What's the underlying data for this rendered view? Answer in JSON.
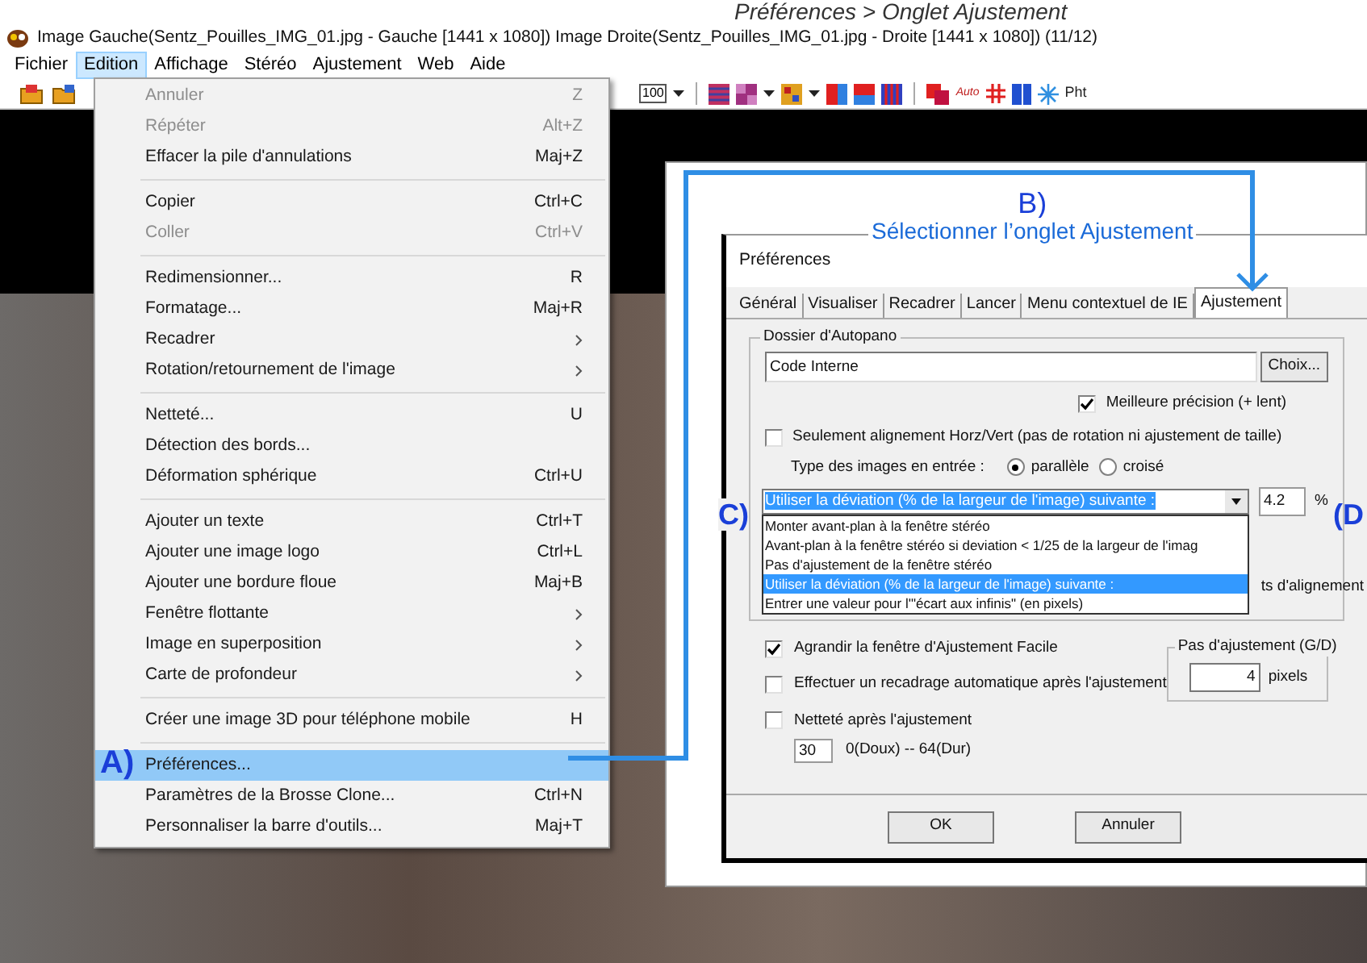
{
  "caption": "Préférences > Onglet Ajustement",
  "window": {
    "title": "Image Gauche(Sentz_Pouilles_IMG_01.jpg - Gauche [1441 x 1080]) Image Droite(Sentz_Pouilles_IMG_01.jpg - Droite [1441 x 1080])  (11/12)"
  },
  "menubar": [
    {
      "label": "Fichier",
      "selected": false
    },
    {
      "label": "Edition",
      "selected": true
    },
    {
      "label": "Affichage",
      "selected": false
    },
    {
      "label": "Stéréo",
      "selected": false
    },
    {
      "label": "Ajustement",
      "selected": false
    },
    {
      "label": "Web",
      "selected": false
    },
    {
      "label": "Aide",
      "selected": false
    }
  ],
  "toolbar": {
    "zoom_label": "100",
    "auto_label": "Auto",
    "text_label": "Pht"
  },
  "edit_menu": [
    [
      {
        "label": "Annuler",
        "shortcut": "Z",
        "disabled": true,
        "submenu": false,
        "selected": false
      },
      {
        "label": "Répéter",
        "shortcut": "Alt+Z",
        "disabled": true,
        "submenu": false,
        "selected": false
      },
      {
        "label": "Effacer la pile d'annulations",
        "shortcut": "Maj+Z",
        "disabled": false,
        "submenu": false,
        "selected": false
      }
    ],
    [
      {
        "label": "Copier",
        "shortcut": "Ctrl+C",
        "disabled": false,
        "submenu": false,
        "selected": false
      },
      {
        "label": "Coller",
        "shortcut": "Ctrl+V",
        "disabled": true,
        "submenu": false,
        "selected": false
      }
    ],
    [
      {
        "label": "Redimensionner...",
        "shortcut": "R",
        "disabled": false,
        "submenu": false,
        "selected": false
      },
      {
        "label": "Formatage...",
        "shortcut": "Maj+R",
        "disabled": false,
        "submenu": false,
        "selected": false
      },
      {
        "label": "Recadrer",
        "disabled": false,
        "submenu": true,
        "selected": false
      },
      {
        "label": "Rotation/retournement de l'image",
        "disabled": false,
        "submenu": true,
        "selected": false
      }
    ],
    [
      {
        "label": "Netteté...",
        "shortcut": "U",
        "disabled": false,
        "submenu": false,
        "selected": false
      },
      {
        "label": "Détection des bords...",
        "disabled": false,
        "submenu": false,
        "selected": false
      },
      {
        "label": "Déformation sphérique",
        "shortcut": "Ctrl+U",
        "disabled": false,
        "submenu": false,
        "selected": false
      }
    ],
    [
      {
        "label": "Ajouter un texte",
        "shortcut": "Ctrl+T",
        "disabled": false,
        "submenu": false,
        "selected": false
      },
      {
        "label": "Ajouter une image logo",
        "shortcut": "Ctrl+L",
        "disabled": false,
        "submenu": false,
        "selected": false
      },
      {
        "label": "Ajouter une bordure floue",
        "shortcut": "Maj+B",
        "disabled": false,
        "submenu": false,
        "selected": false
      },
      {
        "label": "Fenêtre flottante",
        "disabled": false,
        "submenu": true,
        "selected": false
      },
      {
        "label": "Image en superposition",
        "disabled": false,
        "submenu": true,
        "selected": false
      },
      {
        "label": "Carte de profondeur",
        "disabled": false,
        "submenu": true,
        "selected": false
      }
    ],
    [
      {
        "label": "Créer une image 3D pour téléphone mobile",
        "shortcut": "H",
        "disabled": false,
        "submenu": false,
        "selected": false
      }
    ],
    [
      {
        "label": "Préférences...",
        "disabled": false,
        "submenu": false,
        "selected": true
      },
      {
        "label": "Paramètres de la Brosse Clone...",
        "shortcut": "Ctrl+N",
        "disabled": false,
        "submenu": false,
        "selected": false
      },
      {
        "label": "Personnaliser la barre d'outils...",
        "shortcut": "Maj+T",
        "disabled": false,
        "submenu": false,
        "selected": false
      }
    ]
  ],
  "annotations": {
    "a": "A)",
    "b": "B)",
    "b_text": "Sélectionner l’onglet Ajustement",
    "c": "C)",
    "d": "(D"
  },
  "dialog": {
    "title": "Préférences",
    "tabs": [
      {
        "label": "Général",
        "selected": false
      },
      {
        "label": "Visualiser",
        "selected": false
      },
      {
        "label": "Recadrer",
        "selected": false
      },
      {
        "label": "Lancer",
        "selected": false
      },
      {
        "label": "Menu contextuel de IE",
        "selected": false
      },
      {
        "label": "Ajustement",
        "selected": true
      }
    ],
    "autopano_group": "Dossier d'Autopano",
    "autopano_value": "Code Interne",
    "choose_button": "Choix...",
    "best_precision": {
      "label": "Meilleure précision (+ lent)",
      "checked": true
    },
    "only_align": {
      "label": "Seulement alignement Horz/Vert (pas de rotation ni ajustement de taille)",
      "checked": false
    },
    "input_type_label": "Type des images en entrée :",
    "input_types": [
      {
        "label": "parallèle",
        "selected": true
      },
      {
        "label": "croisé",
        "selected": false
      }
    ],
    "window_mode": {
      "value": "Utiliser la déviation (% de la largeur de l'image) suivante :",
      "options": [
        {
          "label": "Monter avant-plan à la fenêtre stéréo",
          "selected": false
        },
        {
          "label": "Avant-plan à la fenêtre stéréo si deviation < 1/25 de la largeur de l'imag",
          "selected": false
        },
        {
          "label": "Pas d'ajustement de la fenêtre stéréo",
          "selected": false
        },
        {
          "label": "Utiliser la déviation (% de la largeur de l'image) suivante :",
          "selected": true
        },
        {
          "label": "Entrer une valeur pour l'\"écart aux infinis\" (en pixels)",
          "selected": false
        }
      ]
    },
    "deviation_value": "4.2",
    "deviation_unit": "%",
    "hidden_option_text": "ts d'alignement",
    "checks": [
      {
        "label": "Agrandir la fenêtre d'Ajustement Facile",
        "checked": true
      },
      {
        "label": "Effectuer un recadrage automatique après l'ajustement",
        "checked": false
      },
      {
        "label": "Netteté après l'ajustement",
        "checked": false
      }
    ],
    "sharpness_value": "30",
    "sharpness_range": "0(Doux) -- 64(Dur)",
    "step_group": "Pas d'ajustement (G/D)",
    "step_value": "4",
    "step_unit": "pixels",
    "buttons": [
      "OK",
      "Annuler"
    ]
  }
}
